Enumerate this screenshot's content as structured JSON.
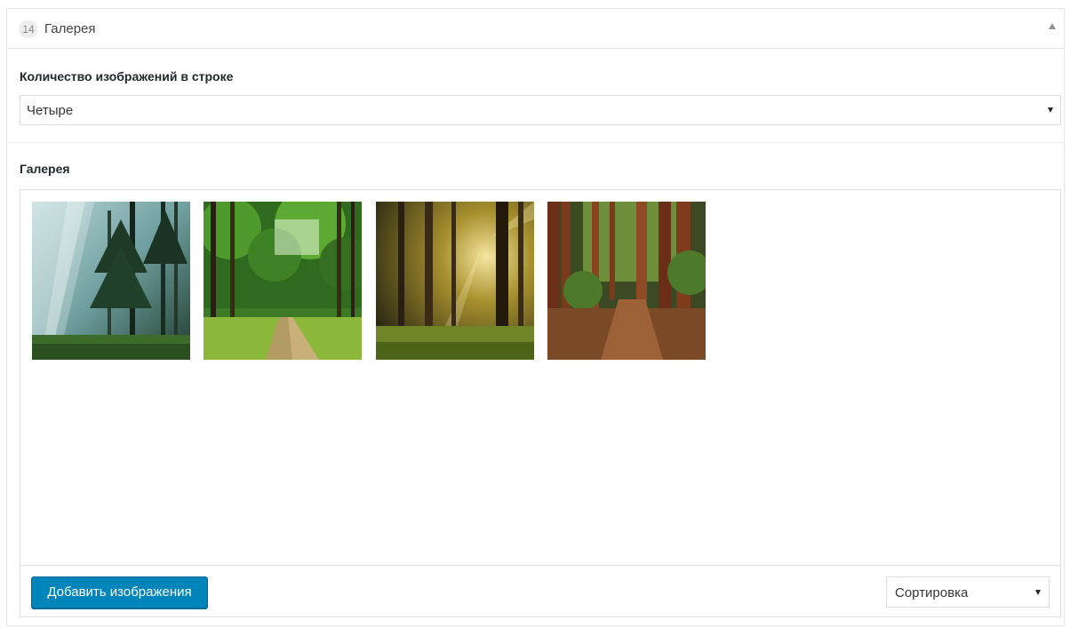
{
  "panel": {
    "order_number": "14",
    "title": "Галерея"
  },
  "columns_field": {
    "label": "Количество изображений в строке",
    "selected": "Четыре"
  },
  "gallery_field": {
    "label": "Галерея",
    "images": [
      {
        "subject": "misty forest with sun rays"
      },
      {
        "subject": "green forest path"
      },
      {
        "subject": "sunlit forest at sunset"
      },
      {
        "subject": "redwood forest trail"
      }
    ]
  },
  "toolbar": {
    "add_label": "Добавить изображения",
    "sort_selected": "Сортировка"
  },
  "colors": {
    "primary_button": "#0085ba",
    "border": "#dddddd"
  }
}
